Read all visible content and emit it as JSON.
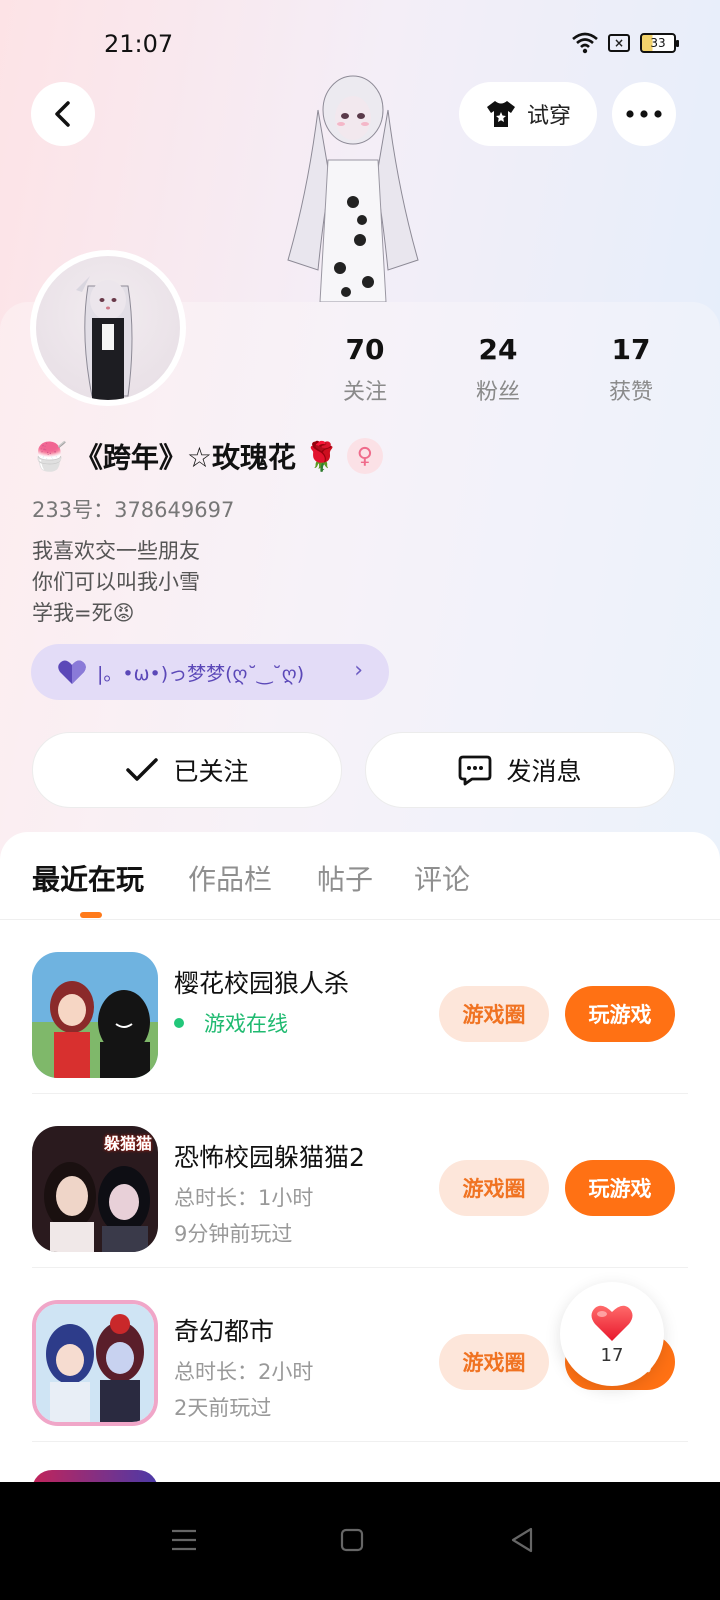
{
  "status_bar": {
    "time": "21:07",
    "battery": "33"
  },
  "header": {
    "try_on_label": "试穿"
  },
  "profile": {
    "stats": [
      {
        "value": "70",
        "label": "关注"
      },
      {
        "value": "24",
        "label": "粉丝"
      },
      {
        "value": "17",
        "label": "获赞"
      }
    ],
    "name": "《跨年》☆玫瑰花",
    "name_emoji_left": "🍧",
    "name_emoji_right": "🌹",
    "gender_symbol": "♀",
    "uid": "233号：378649697",
    "bio_lines": [
      "我喜欢交一些朋友",
      "你们可以叫我小雪",
      "学我=死😡"
    ],
    "cp_tag": "|。•ω•)っ梦梦(ღ˘‿˘ღ)"
  },
  "actions": {
    "follow_label": "已关注",
    "message_label": "发消息"
  },
  "tabs": [
    {
      "label": "最近在玩",
      "active": true
    },
    {
      "label": "作品栏",
      "active": false
    },
    {
      "label": "帖子",
      "active": false
    },
    {
      "label": "评论",
      "active": false
    }
  ],
  "games": [
    {
      "title": "樱花校园狼人杀",
      "online_text": "游戏在线",
      "circle_label": "游戏圈",
      "play_label": "玩游戏"
    },
    {
      "title": "恐怖校园躲猫猫2",
      "duration": "总时长：1小时",
      "last_played": "9分钟前玩过",
      "circle_label": "游戏圈",
      "play_label": "玩游戏",
      "icon_text": "躲猫猫"
    },
    {
      "title": "奇幻都市",
      "duration": "总时长：2小时",
      "last_played": "2天前玩过",
      "circle_label": "游戏圈",
      "play_label": "玩游戏"
    }
  ],
  "like_float": {
    "count": "17"
  },
  "colors": {
    "accent": "#ff7114",
    "accent_light": "#fde6da",
    "online": "#22c77a",
    "cp_bg": "#e3dcf7"
  }
}
